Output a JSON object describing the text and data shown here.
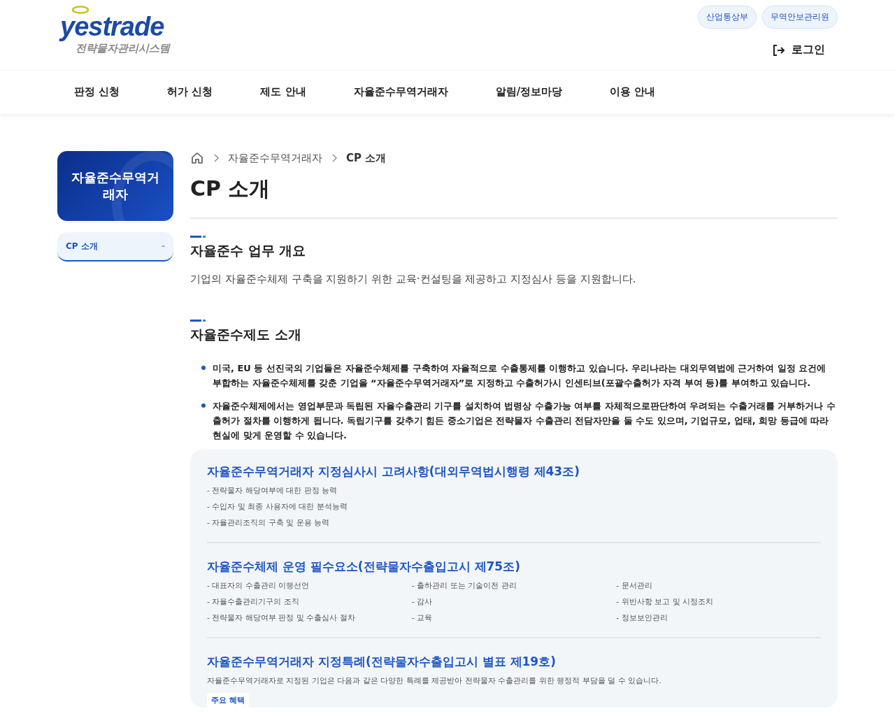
{
  "header": {
    "logo": {
      "wordmark": "yestrade",
      "subtitle": "전략물자관리시스템"
    },
    "agency_links": [
      "산업통상부",
      "무역안보관리원"
    ],
    "login": "로그인"
  },
  "nav": [
    {
      "label": "판정 신청",
      "selected": false
    },
    {
      "label": "허가 신청",
      "selected": false
    },
    {
      "label": "제도 안내",
      "selected": false
    },
    {
      "label": "자율준수무역거래자",
      "selected": false
    },
    {
      "label": "알림/정보마당",
      "selected": false
    },
    {
      "label": "이용 안내",
      "selected": false
    }
  ],
  "sidebar": {
    "title": "자율준수무역거래자",
    "items": [
      {
        "label": "CP 소개",
        "selected": true,
        "toggle": "-"
      }
    ]
  },
  "breadcrumb": [
    "자율준수무역거래자",
    "CP 소개"
  ],
  "page_title": "CP 소개",
  "sections": [
    {
      "heading": "자율준수 업무 개요",
      "kind": "paragraph",
      "text": "기업의 자율준수체제 구축을 지원하기 위한 교육·컨설팅을 제공하고 지정심사 등을 지원합니다."
    },
    {
      "heading": "자율준수제도 소개",
      "kind": "bullets",
      "bullets": [
        "미국, EU 등 선진국의 기업들은 자율준수체제를 구축하여 자율적으로 수출통제를 이행하고 있습니다. 우리나라는 대외무역법에 근거하여 일정 요건에 부합하는 자율준수체제를 갖춘 기업을 “자율준수무역거래자”로 지정하고 수출허가시 인센티브(포괄수출허가 자격 부여 등)를 부여하고 있습니다.",
        "자율준수체제에서는 영업부문과 독립된 자율수출관리 기구를 설치하여 법령상 수출가능 여부를 자체적으로판단하여 우려되는 수출거래를 거부하거나 수출허가 절차를 이행하게 됩니다. 독립기구를 갖추기 힘든 중소기업은 전략물자 수출관리 전담자만을 둘 수도 있으며, 기업규모, 업태, 희망 등급에 따라 현실에 맞게 운영할 수 있습니다."
      ]
    }
  ],
  "info_box": [
    {
      "title": "자율준수무역거래자 지정심사시 고려사항(대외무역법시행령 제43조)",
      "kind": "list",
      "items": [
        "- 전략물자 해당여부에 대한 판정 능력",
        "- 수입자 및 최종 사용자에 대한 분석능력",
        "- 자율관리조직의 구축 및 운용 능력"
      ]
    },
    {
      "title": "자율준수체제 운영 필수요소(전략물자수출입고시 제75조)",
      "kind": "grid",
      "items": [
        "- 대표자의 수출관리 이행선언",
        "- 출하관리 또는 기술이전 관리",
        "- 문서관리",
        "- 자율수출관리기구의 조직",
        "- 감사",
        "- 위반사항 보고 및 시정조치",
        "- 전략물자 해당여부 판정 및 수출심사 절차",
        "- 교육",
        "- 정보보안관리"
      ]
    },
    {
      "title": "자율준수무역거래자 지정특례(전략물자수출입고시 별표 제19호)",
      "kind": "text",
      "text": "자율준수무역거래자로 지정된 기업은 다음과 같은 다양한 특례를 제공받아 전략물자 수출관리를 위한 행정적 부담을 덜 수 있습니다.",
      "tag": "주요 혜택"
    }
  ]
}
